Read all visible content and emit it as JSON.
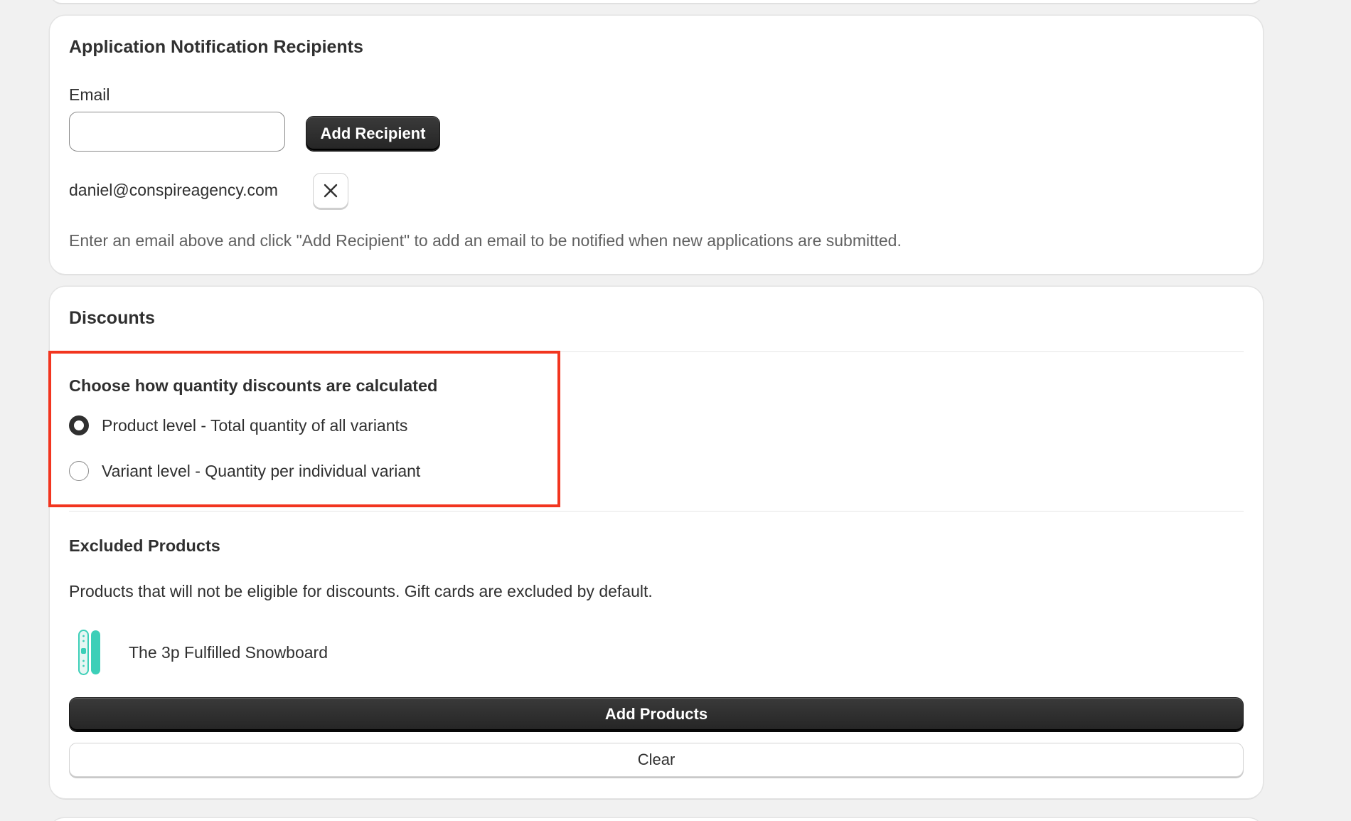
{
  "notifications": {
    "title": "Application Notification Recipients",
    "email_label": "Email",
    "email_value": "",
    "add_button_label": "Add Recipient",
    "recipients": [
      "daniel@conspireagency.com"
    ],
    "remove_icon": "close-icon",
    "help_text": "Enter an email above and click \"Add Recipient\" to add an email to be notified when new applications are submitted."
  },
  "discounts": {
    "title": "Discounts",
    "calculation": {
      "heading": "Choose how quantity discounts are calculated",
      "options": [
        {
          "label": "Product level - Total quantity of all variants",
          "checked": true
        },
        {
          "label": "Variant level - Quantity per individual variant",
          "checked": false
        }
      ],
      "highlight_color": "#f2351f"
    },
    "excluded": {
      "heading": "Excluded Products",
      "description": "Products that will not be eligible for discounts. Gift cards are excluded by default.",
      "products": [
        {
          "title": "The 3p Fulfilled Snowboard",
          "thumb_icon": "snowboard-icon"
        }
      ],
      "add_button_label": "Add Products",
      "clear_button_label": "Clear"
    }
  },
  "colors": {
    "background": "#f1f1f1",
    "card": "#ffffff",
    "primary_button": "#303030",
    "highlight": "#f2351f",
    "snowboard_teal": "#3ccfb8"
  }
}
